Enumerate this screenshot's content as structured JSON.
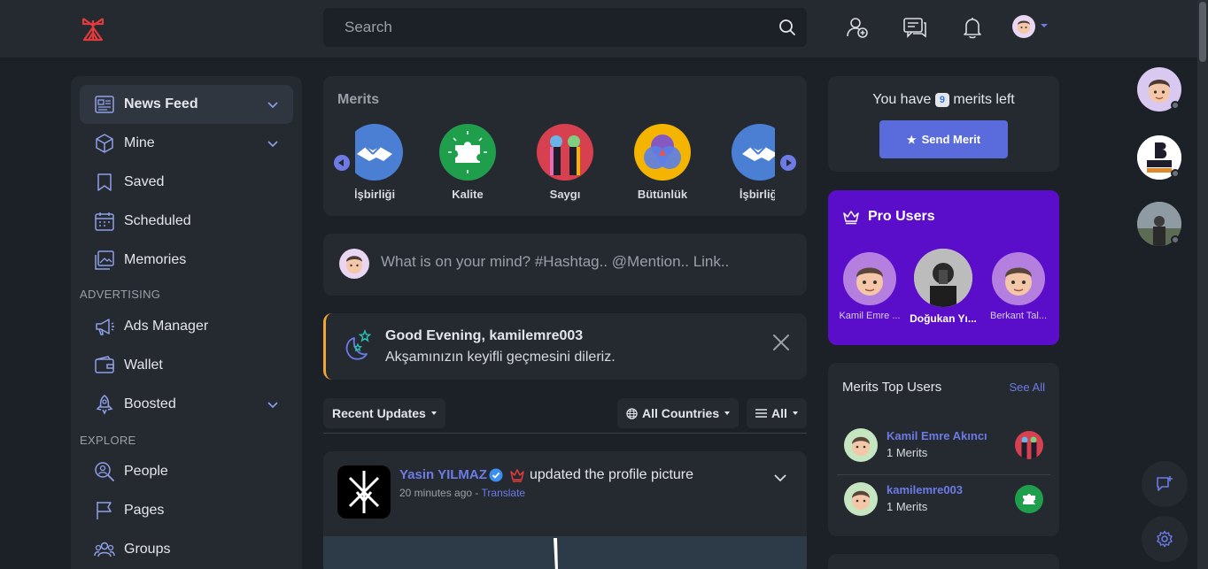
{
  "header": {
    "search_placeholder": "Search",
    "icons": [
      "logo-icon",
      "search-icon",
      "add-friend-icon",
      "messages-icon",
      "notifications-icon",
      "avatar"
    ]
  },
  "sidebar": {
    "items": [
      {
        "label": "News Feed",
        "icon": "news-feed-icon",
        "active": true,
        "chevron": true
      },
      {
        "label": "Mine",
        "icon": "box-icon",
        "chevron": true
      },
      {
        "label": "Saved",
        "icon": "bookmark-icon"
      },
      {
        "label": "Scheduled",
        "icon": "calendar-icon"
      },
      {
        "label": "Memories",
        "icon": "photos-icon"
      },
      {
        "label": "Ads Manager",
        "icon": "megaphone-icon"
      },
      {
        "label": "Wallet",
        "icon": "wallet-icon"
      },
      {
        "label": "Boosted",
        "icon": "rocket-icon",
        "chevron": true
      },
      {
        "label": "People",
        "icon": "people-search-icon"
      },
      {
        "label": "Pages",
        "icon": "flag-icon"
      },
      {
        "label": "Groups",
        "icon": "groups-icon"
      }
    ],
    "sections": {
      "advertising": "ADVERTISING",
      "explore": "EXPLORE"
    }
  },
  "merits": {
    "title": "Merits",
    "items": [
      {
        "label": "İşbirliği",
        "color": "#4a7fd4"
      },
      {
        "label": "Kalite",
        "color": "#1f9e4b"
      },
      {
        "label": "Saygı",
        "color": "#d7404f"
      },
      {
        "label": "Bütünlük",
        "color": "#f4b400"
      },
      {
        "label": "İşbirliği",
        "color": "#4a7fd4"
      }
    ]
  },
  "composer": {
    "placeholder": "What is on your mind? #Hashtag.. @Mention.. Link.."
  },
  "greeting": {
    "title": "Good Evening, kamilemre003",
    "subtitle": "Akşamınızın keyifli geçmesini dileriz."
  },
  "filters": {
    "recent": "Recent Updates",
    "countries": "All Countries",
    "all": "All"
  },
  "post": {
    "author": "Yasin YILMAZ",
    "action": "updated the profile picture",
    "time": "20 minutes ago - ",
    "translate": "Translate"
  },
  "right": {
    "merits_prefix": "You have",
    "merits_count": "9",
    "merits_suffix": "merits left",
    "send_merit": "Send Merit",
    "pro_title": "Pro Users",
    "pro_users": [
      "Kamil Emre ...",
      "Doğukan Yı...",
      "Berkant Tal..."
    ],
    "top_users_title": "Merits Top Users",
    "see_all": "See All",
    "top_users": [
      {
        "name": "Kamil Emre Akıncı",
        "count": "1 Merits"
      },
      {
        "name": "kamilemre003",
        "count": "1 Merits"
      }
    ]
  },
  "colors": {
    "accent": "#6c7be6",
    "pro_bg": "#5b0ec9",
    "greeting_border": "#f0a433"
  }
}
